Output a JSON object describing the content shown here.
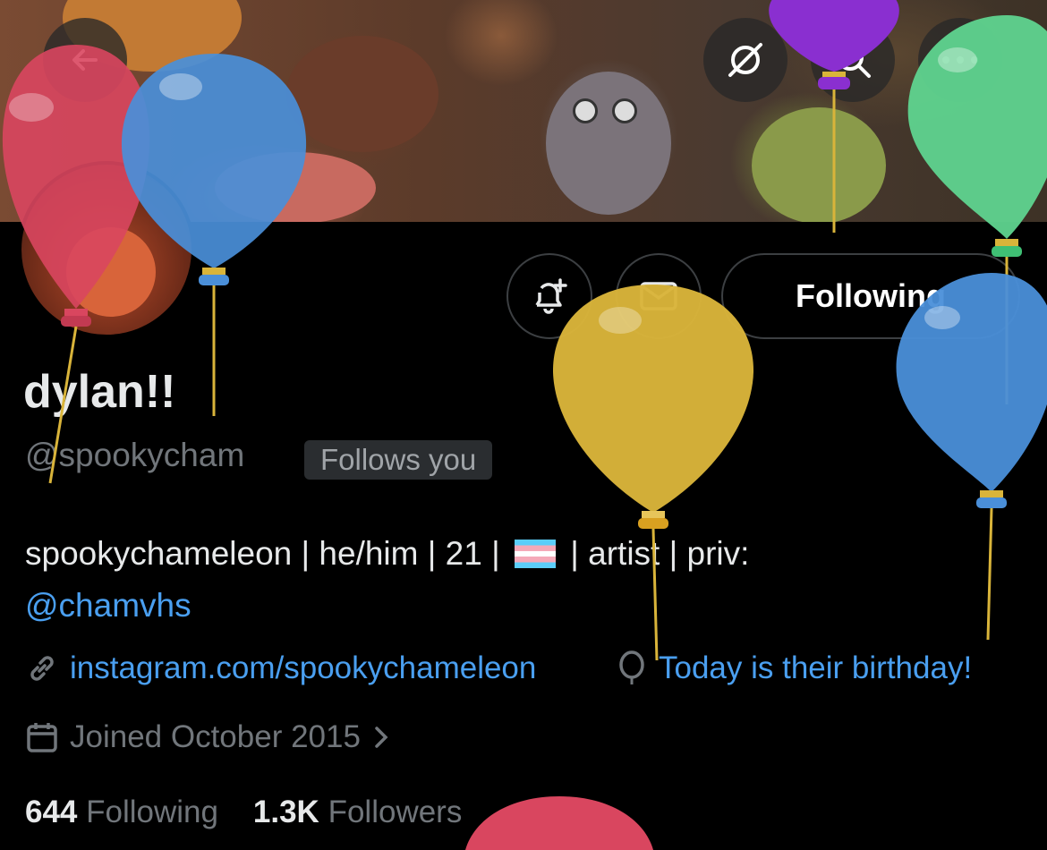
{
  "header": {
    "back_icon": "back-arrow-icon",
    "right_icons": [
      "grok-icon",
      "search-icon",
      "more-icon"
    ]
  },
  "actions": {
    "notify_icon": "bell-plus-icon",
    "message_icon": "envelope-icon",
    "following_label": "Following"
  },
  "profile": {
    "display_name": "dylan!!",
    "handle": "@spookycham",
    "follows_you": "Follows you",
    "bio_text": "spookychameleon | he/him | 21 |",
    "bio_text_2": "| artist | priv:",
    "bio_mention": "@chamvhs",
    "website": "instagram.com/spookychameleon",
    "birthday": "Today is their birthday!",
    "joined": "Joined October 2015"
  },
  "stats": {
    "following_count": "644",
    "following_label": "Following",
    "followers_count": "1.3K",
    "followers_label": "Followers"
  },
  "colors": {
    "background": "#000000",
    "link": "#4a9ff0",
    "muted": "#71767b",
    "balloon_red": "#d9465f",
    "balloon_blue": "#4a8fd9",
    "balloon_yellow": "#d9b43a",
    "balloon_green": "#5fd48f",
    "balloon_purple": "#8a2fd0"
  }
}
